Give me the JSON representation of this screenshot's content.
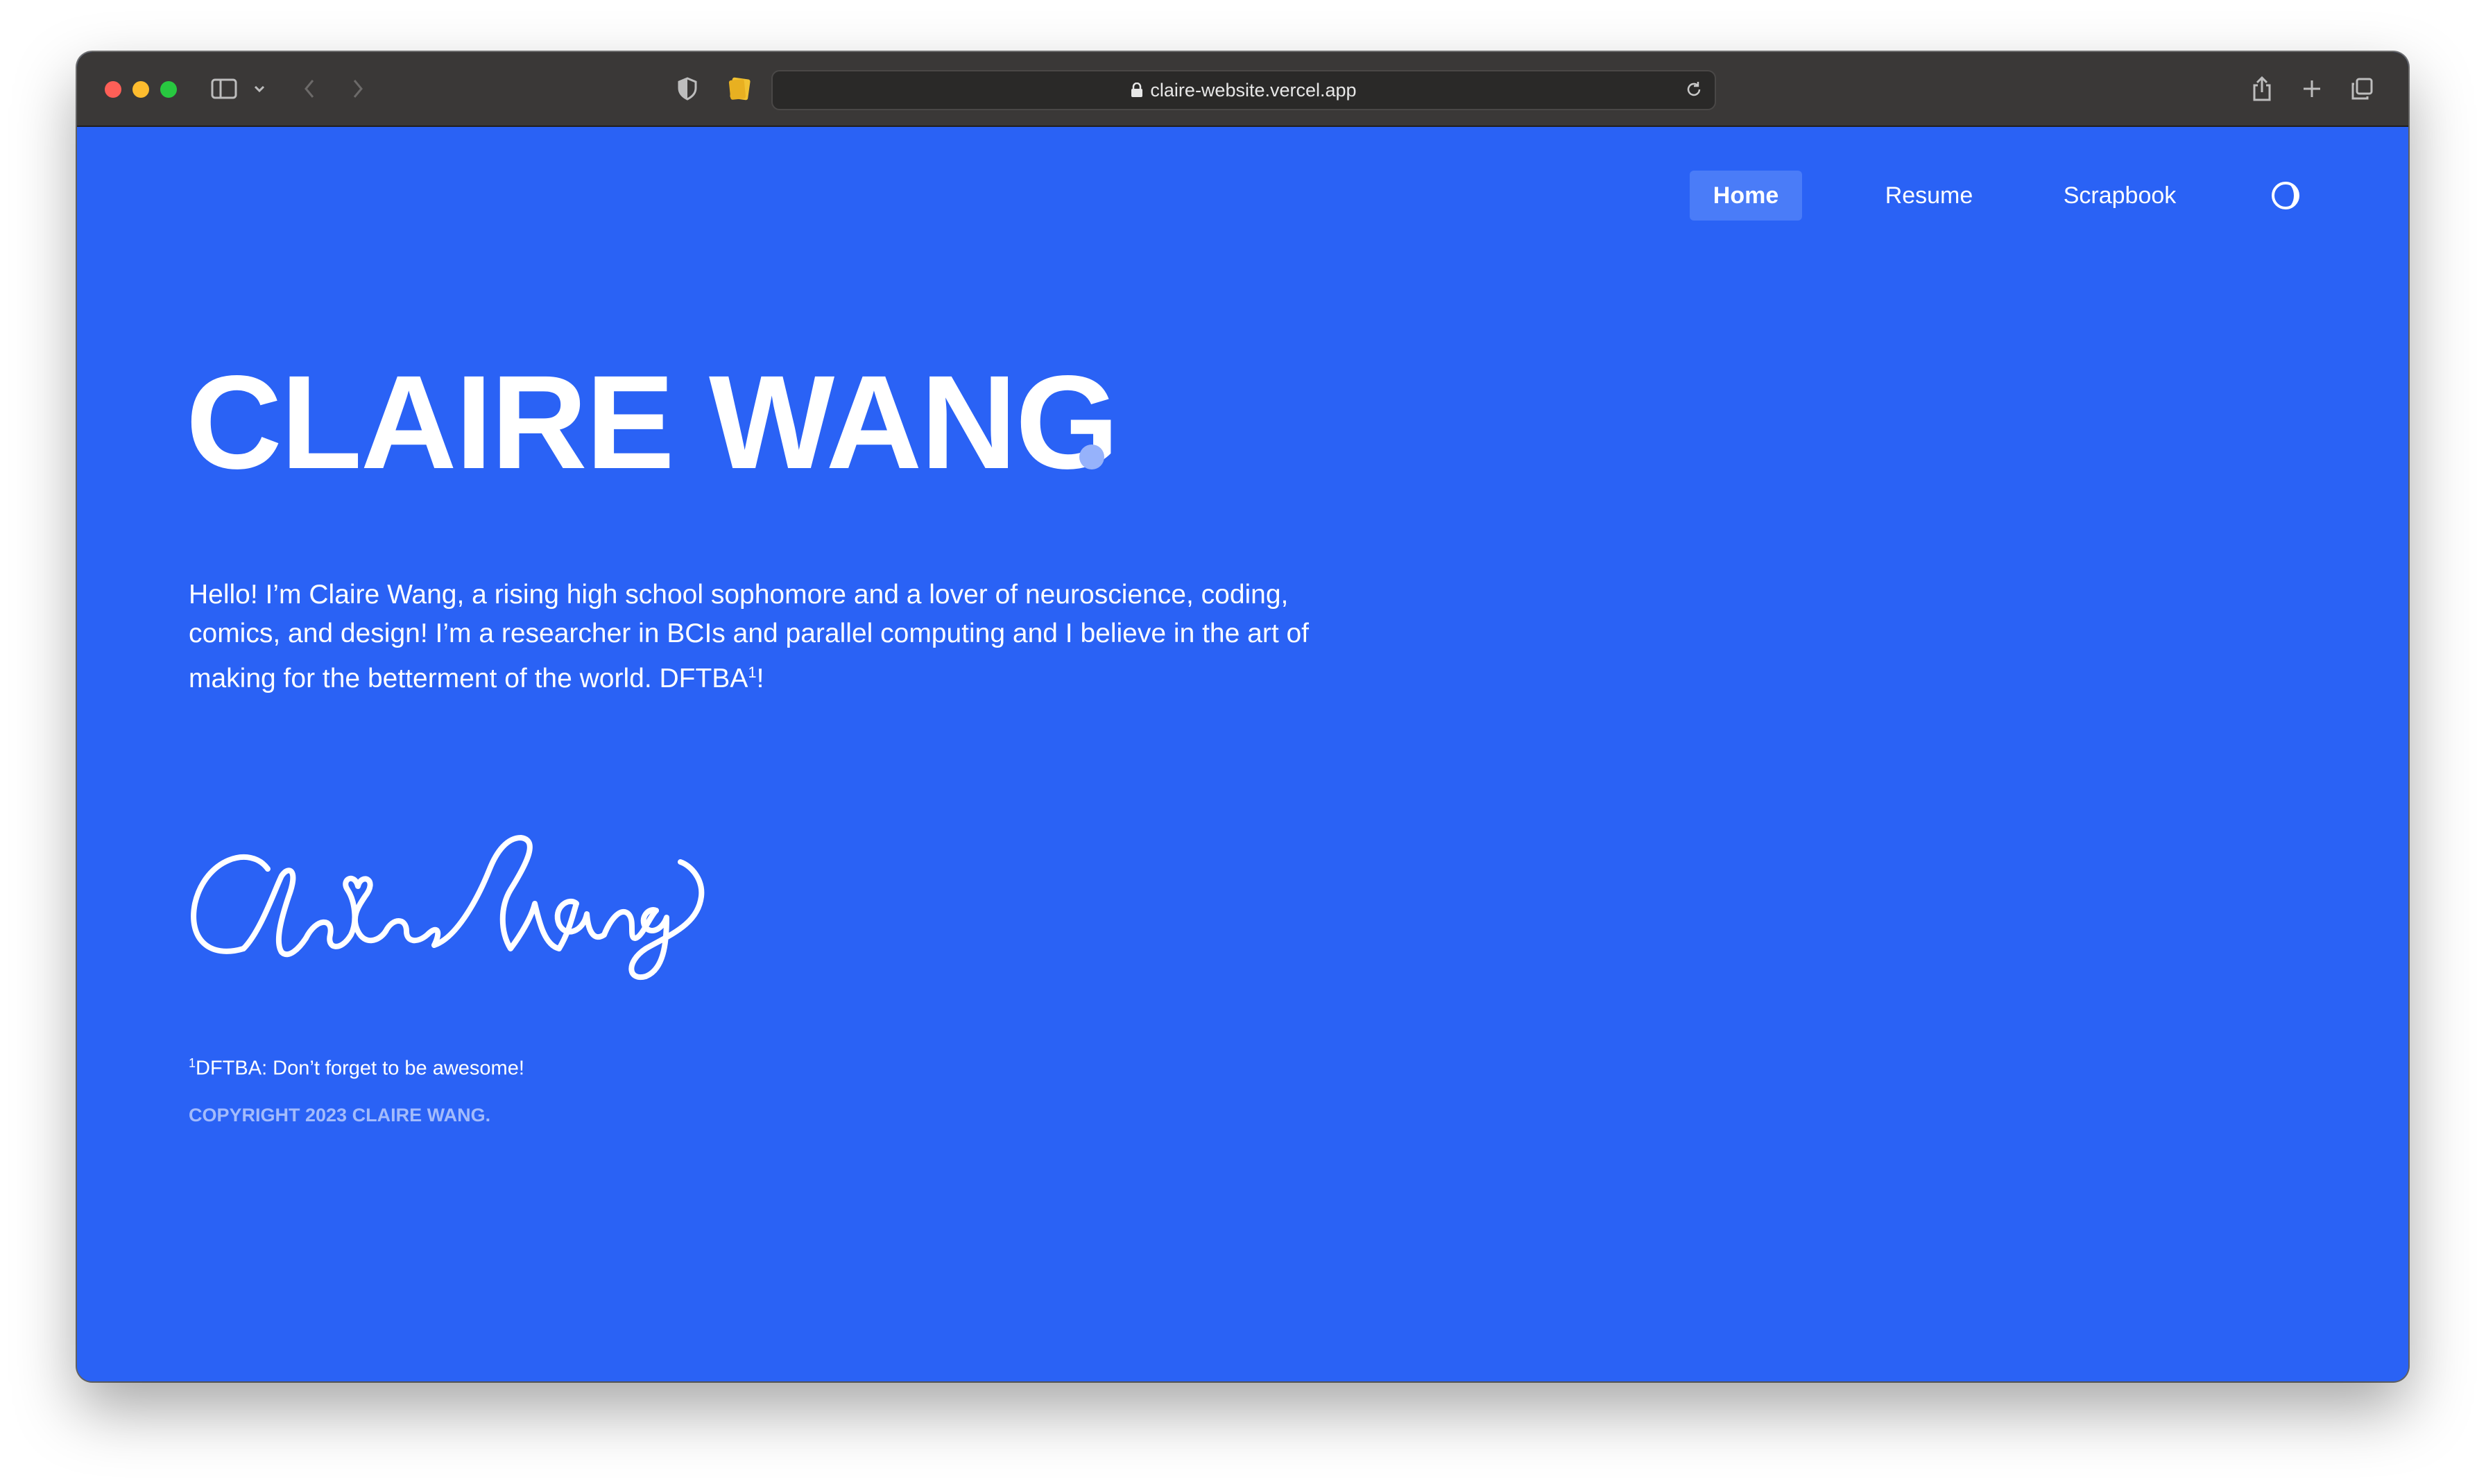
{
  "browser": {
    "url": "claire-website.vercel.app",
    "icons": [
      "sidebar-icon",
      "chevron-down-icon",
      "back-icon",
      "forward-icon",
      "shield-icon",
      "notes-extension-icon",
      "lock-icon",
      "reload-icon",
      "share-icon",
      "new-tab-icon",
      "tab-overview-icon"
    ]
  },
  "nav": {
    "items": [
      {
        "label": "Home",
        "active": true
      },
      {
        "label": "Resume",
        "active": false
      },
      {
        "label": "Scrapbook",
        "active": false
      }
    ],
    "theme_toggle_icon": "theme-toggle-icon"
  },
  "hero": {
    "name": "CLAIRE WANG",
    "bio_text": "Hello! I’m Claire Wang, a rising high school sophomore and a lover of neuroscience, coding, comics, and design! I’m a researcher in BCIs and parallel computing and I believe in the art of making for the betterment of the world. DFTBA",
    "bio_sup": "1",
    "bio_end": "!",
    "signature": "Claire Wang"
  },
  "footer": {
    "footnote_sup": "1",
    "footnote_text": "DFTBA: Don’t forget to be awesome!",
    "copyright": "COPYRIGHT 2023 CLAIRE WANG."
  },
  "colors": {
    "page_background": "#2a62f5",
    "active_nav": "#4a7cf8",
    "accent_dot": "#96b2fb",
    "copyright_text": "#a3bbfb",
    "titlebar": "#3a3837"
  }
}
